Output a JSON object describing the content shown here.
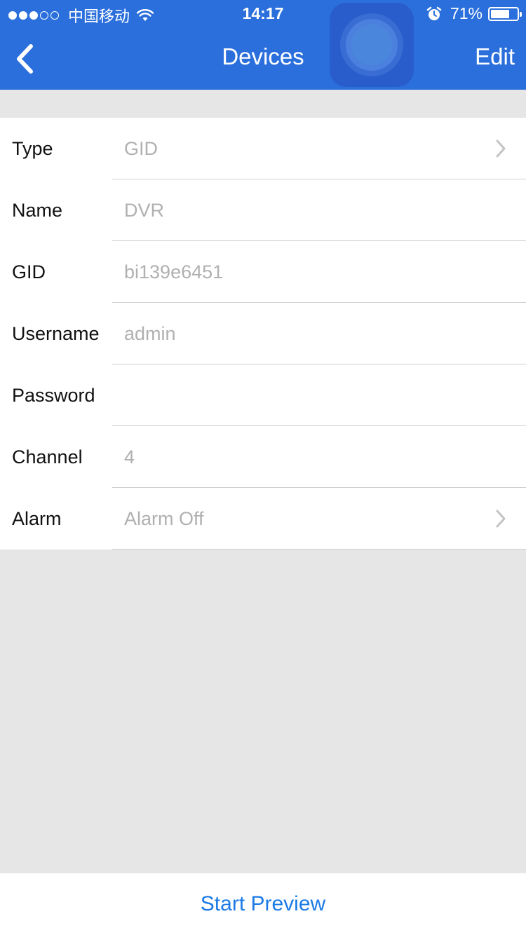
{
  "status_bar": {
    "signal_dots": [
      true,
      true,
      true,
      false,
      false
    ],
    "carrier": "中国移动",
    "time": "14:17",
    "battery_percent": "71%",
    "battery_level": 0.71
  },
  "nav": {
    "title": "Devices",
    "edit_label": "Edit",
    "back_icon": "chevron-left-icon"
  },
  "form": {
    "rows": [
      {
        "label": "Type",
        "value": "GID",
        "has_chevron": true
      },
      {
        "label": "Name",
        "value": "DVR",
        "has_chevron": false
      },
      {
        "label": "GID",
        "value": "bi139e6451",
        "has_chevron": false
      },
      {
        "label": "Username",
        "value": "admin",
        "has_chevron": false
      },
      {
        "label": "Password",
        "value": "",
        "has_chevron": false
      },
      {
        "label": "Channel",
        "value": "4",
        "has_chevron": false
      },
      {
        "label": "Alarm",
        "value": "Alarm Off",
        "has_chevron": true
      }
    ]
  },
  "footer": {
    "start_preview_label": "Start Preview"
  },
  "colors": {
    "nav_bar": "#2a6fdc",
    "background": "#e6e6e6",
    "value_text": "#b0b0b0",
    "action_blue": "#1c7ae6"
  }
}
